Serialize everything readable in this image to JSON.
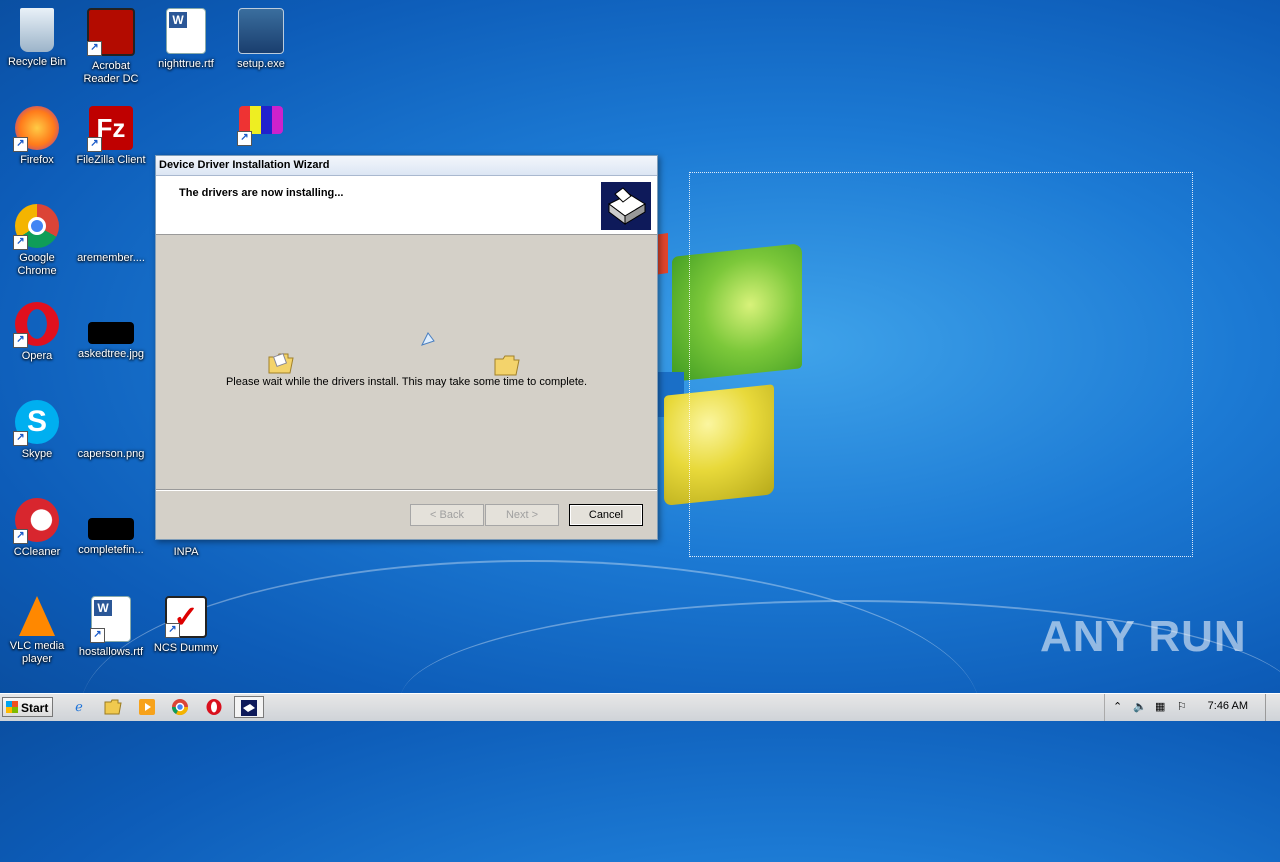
{
  "desktop": {
    "icons": [
      {
        "label": "Recycle Bin",
        "icon": "recycle-bin-icon"
      },
      {
        "label": "Acrobat Reader DC",
        "icon": "acrobat-reader-icon"
      },
      {
        "label": "nighttrue.rtf",
        "icon": "word-document-icon"
      },
      {
        "label": "setup.exe",
        "icon": "setup-installer-icon"
      },
      {
        "label": "Firefox",
        "icon": "firefox-icon"
      },
      {
        "label": "FileZilla Client",
        "icon": "filezilla-icon"
      },
      {
        "label": "Google Chrome",
        "icon": "chrome-icon"
      },
      {
        "label": "aremember....",
        "icon": "file-icon"
      },
      {
        "label": "Opera",
        "icon": "opera-icon"
      },
      {
        "label": "askedtree.jpg",
        "icon": "image-file-icon"
      },
      {
        "label": "Skype",
        "icon": "skype-icon"
      },
      {
        "label": "caperson.png",
        "icon": "image-file-icon"
      },
      {
        "label": "CCleaner",
        "icon": "ccleaner-icon"
      },
      {
        "label": "completefin...",
        "icon": "image-file-icon"
      },
      {
        "label": "INPA",
        "icon": "inpa-icon"
      },
      {
        "label": "VLC media player",
        "icon": "vlc-icon"
      },
      {
        "label": "hostallows.rtf",
        "icon": "word-document-icon"
      },
      {
        "label": "NCS Dummy",
        "icon": "ncs-dummy-icon"
      }
    ]
  },
  "dialog": {
    "title": "Device Driver Installation Wizard",
    "heading": "The drivers are now installing...",
    "message": "Please wait while the drivers install. This may take some time to complete.",
    "buttons": {
      "back": "< Back",
      "next": "Next >",
      "cancel": "Cancel"
    }
  },
  "taskbar": {
    "start_label": "Start",
    "pinned": [
      "internet-explorer-icon",
      "explorer-folder-icon",
      "media-player-icon",
      "chrome-icon",
      "opera-icon",
      "driver-wizard-icon"
    ],
    "clock": "7:46 AM"
  },
  "watermark": "ANY RUN",
  "colors": {
    "wallpaper": "#1c7ad4",
    "dialog_bg": "#d4d0c8",
    "header_icon_bg": "#0e1a5a"
  }
}
